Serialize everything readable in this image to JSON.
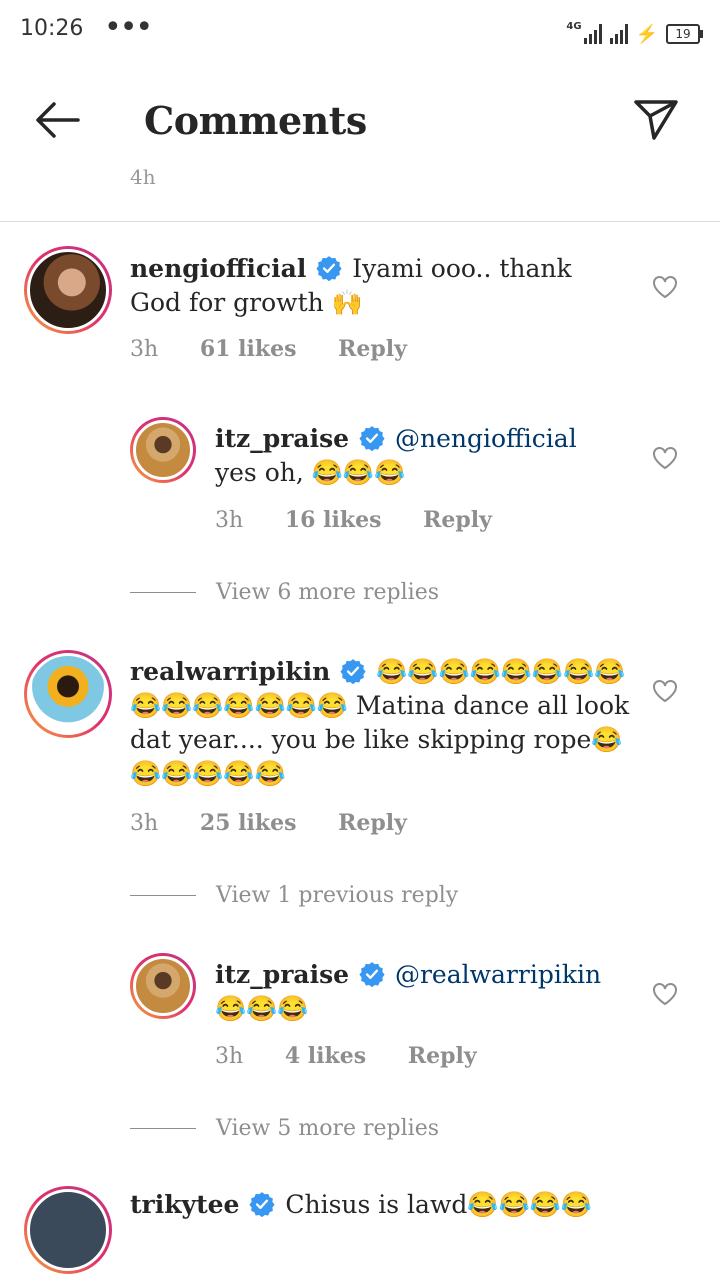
{
  "status_bar": {
    "time": "10:26",
    "dots": "•••",
    "network": "4G",
    "battery": "19"
  },
  "header": {
    "title": "Comments"
  },
  "partial_time": "4h",
  "comments": [
    {
      "username": "nengiofficial",
      "text": "Iyami ooo.. thank God for growth 🙌",
      "time": "3h",
      "likes": "61 likes",
      "reply": "Reply"
    },
    {
      "username": "itz_praise",
      "mention": "@nengiofficial",
      "text": "yes oh, 😂😂😂",
      "time": "3h",
      "likes": "16 likes",
      "reply": "Reply"
    },
    {
      "username": "realwarripikin",
      "text": "😂😂😂😂😂😂😂😂😂😂😂😂😂😂😂 Matina dance all look dat year.... you be like skipping rope😂😂😂😂😂😂",
      "time": "3h",
      "likes": "25 likes",
      "reply": "Reply"
    },
    {
      "username": "itz_praise",
      "mention": "@realwarripikin",
      "text": "😂😂😂",
      "time": "3h",
      "likes": "4 likes",
      "reply": "Reply"
    },
    {
      "username": "trikytee",
      "text": "Chisus is lawd😂😂😂😂"
    }
  ],
  "view_replies": [
    "View 6 more replies",
    "View 1 previous reply",
    "View 5 more replies"
  ]
}
